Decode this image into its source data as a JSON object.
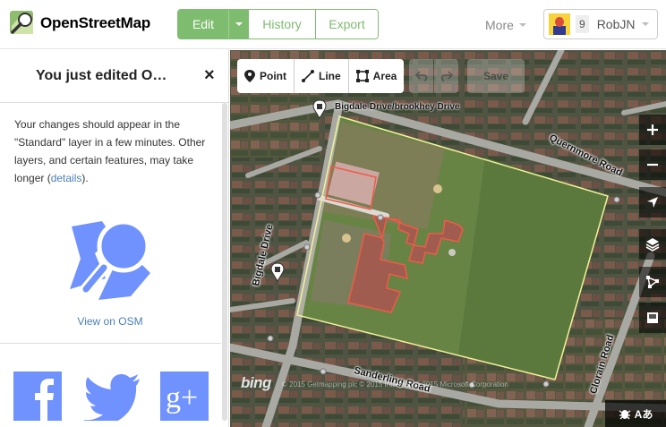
{
  "header": {
    "logo_text": "OpenStreetMap",
    "edit_label": "Edit",
    "history_label": "History",
    "export_label": "Export",
    "more_label": "More",
    "user_count": "9",
    "username": "RobJN",
    "accent_color": "#7ebc6f"
  },
  "sidebar": {
    "title": "You just edited O…",
    "close_symbol": "×",
    "message_part1": "Your changes should appear in the \"Standard\" layer in a few minutes. Other layers, and certain features, may take longer (",
    "details_link": "details",
    "message_part2": ").",
    "view_on_osm": "View on OSM",
    "share": [
      "facebook-icon",
      "twitter-icon",
      "google-plus-icon"
    ]
  },
  "map": {
    "toolbar": {
      "point_label": "Point",
      "line_label": "Line",
      "area_label": "Area",
      "save_label": "Save"
    },
    "labels": {
      "bus_stop": "Bigdale Drive/brookhey Drive",
      "street_bigdale": "Bigdale Drive",
      "street_quernmore": "Quernmore Road",
      "street_sanderling": "Sanderling Road",
      "street_clorain": "Clorain Road"
    },
    "attribution": {
      "bing": "bing",
      "text": "© 2015 Getmapping plc  © 2015 Intermap  © 2015 Microsoft Corporation"
    },
    "footer_text": "Aあ"
  }
}
